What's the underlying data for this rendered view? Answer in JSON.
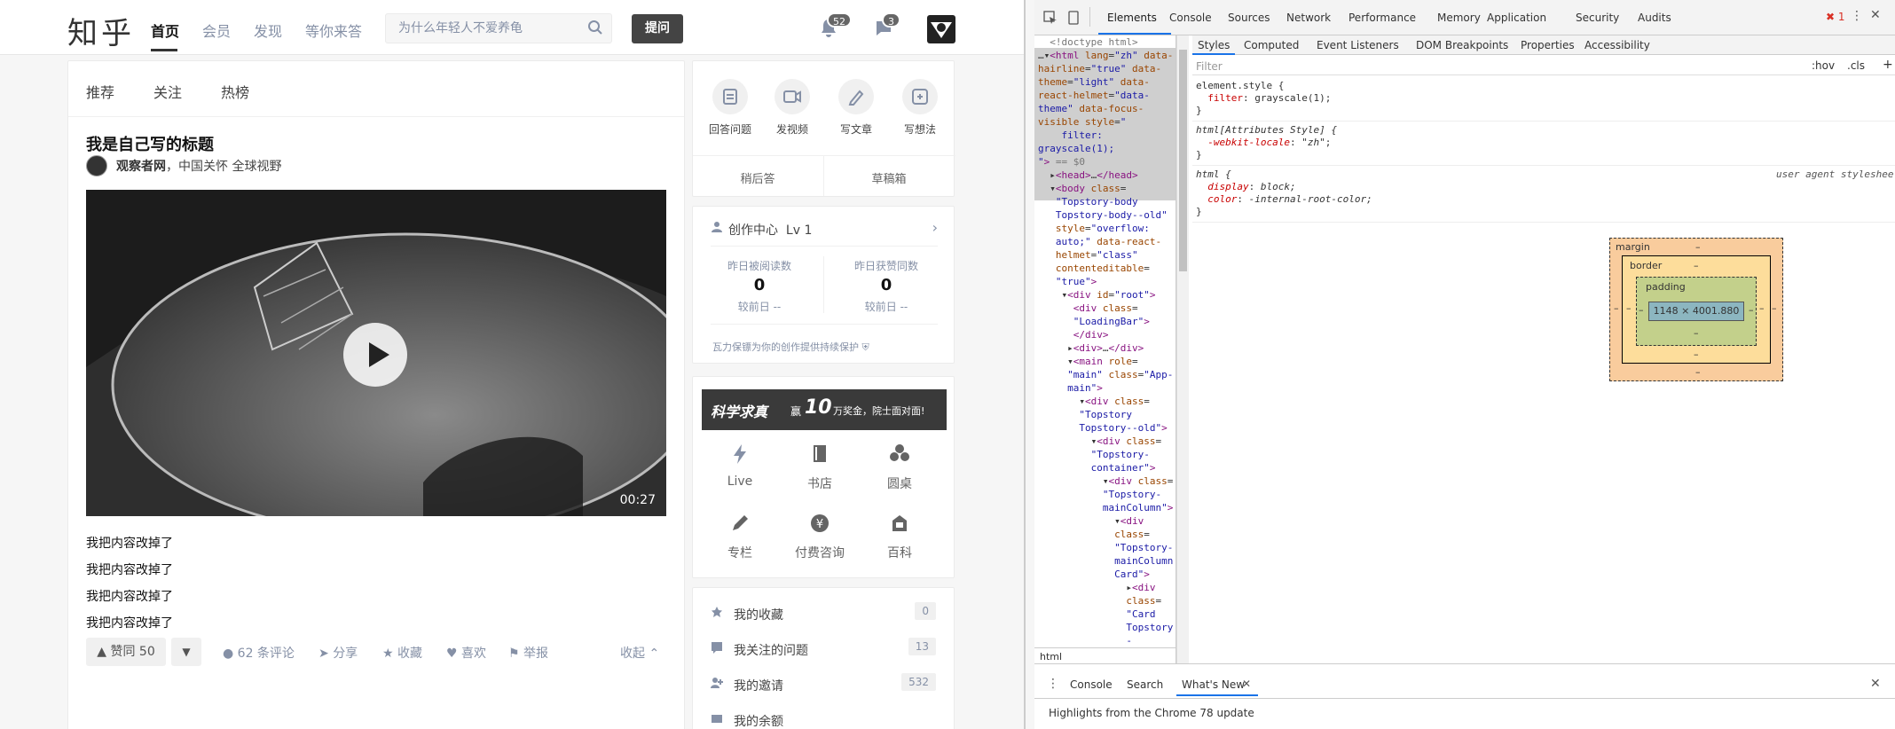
{
  "zhihu": {
    "logo": "知乎",
    "nav": [
      "首页",
      "会员",
      "发现",
      "等你来答"
    ],
    "search_placeholder": "为什么年轻人不爱养龟",
    "ask_label": "提问",
    "notif_count": "52",
    "msg_count": "3",
    "feed_tabs": [
      "推荐",
      "关注",
      "热榜"
    ],
    "article": {
      "title": "我是自己写的标题",
      "author": "观察者网",
      "author_desc": "，中国关怀 全球视野",
      "video_duration": "00:27",
      "paragraphs": [
        "我把内容改掉了",
        "我把内容改掉了",
        "我把内容改掉了",
        "我把内容改掉了"
      ]
    },
    "actions": {
      "vote": "▲ 赞同 50",
      "vote_down": "▼",
      "comments": "62 条评论",
      "share": "分享",
      "collect": "收藏",
      "like": "喜欢",
      "report": "举报",
      "collapse": "收起"
    },
    "create_items": [
      "回答问题",
      "发视频",
      "写文章",
      "写想法"
    ],
    "later": "稍后答",
    "drafts": "草稿箱",
    "creator": {
      "title": "创作中心",
      "level": "Lv 1",
      "stat1_label": "昨日被阅读数",
      "stat1_value": "0",
      "stat1_cmp": "较前日 --",
      "stat2_label": "昨日获赞同数",
      "stat2_value": "0",
      "stat2_cmp": "较前日 --",
      "protect": "瓦力保镖为你的创作提供持续保护"
    },
    "banner": {
      "title": "科学求真",
      "text1": "赢",
      "num": "10",
      "text2": "万奖金，院士面对面!"
    },
    "grid": [
      "Live",
      "书店",
      "圆桌",
      "专栏",
      "付费咨询",
      "百科"
    ],
    "menu": [
      {
        "label": "我的收藏",
        "count": "0"
      },
      {
        "label": "我关注的问题",
        "count": "13"
      },
      {
        "label": "我的邀请",
        "count": "532"
      },
      {
        "label": "我的余额",
        "count": ""
      }
    ]
  },
  "devtools": {
    "tabs": [
      "Elements",
      "Console",
      "Sources",
      "Network",
      "Performance",
      "Memory",
      "Application",
      "Security",
      "Audits"
    ],
    "error_count": "1",
    "style_tabs": [
      "Styles",
      "Computed",
      "Event Listeners",
      "DOM Breakpoints",
      "Properties",
      "Accessibility"
    ],
    "hov": ":hov",
    "cls": ".cls",
    "filter": "Filter",
    "box_size": "1148 × 4001.880",
    "box_labels": [
      "margin",
      "border",
      "padding"
    ],
    "dash": "–",
    "ua": "user agent styleshee",
    "breadcrumb": "html",
    "drawer_tabs": [
      "Console",
      "Search",
      "What's New"
    ],
    "drawer_text": "Highlights from the Chrome 78 update"
  }
}
